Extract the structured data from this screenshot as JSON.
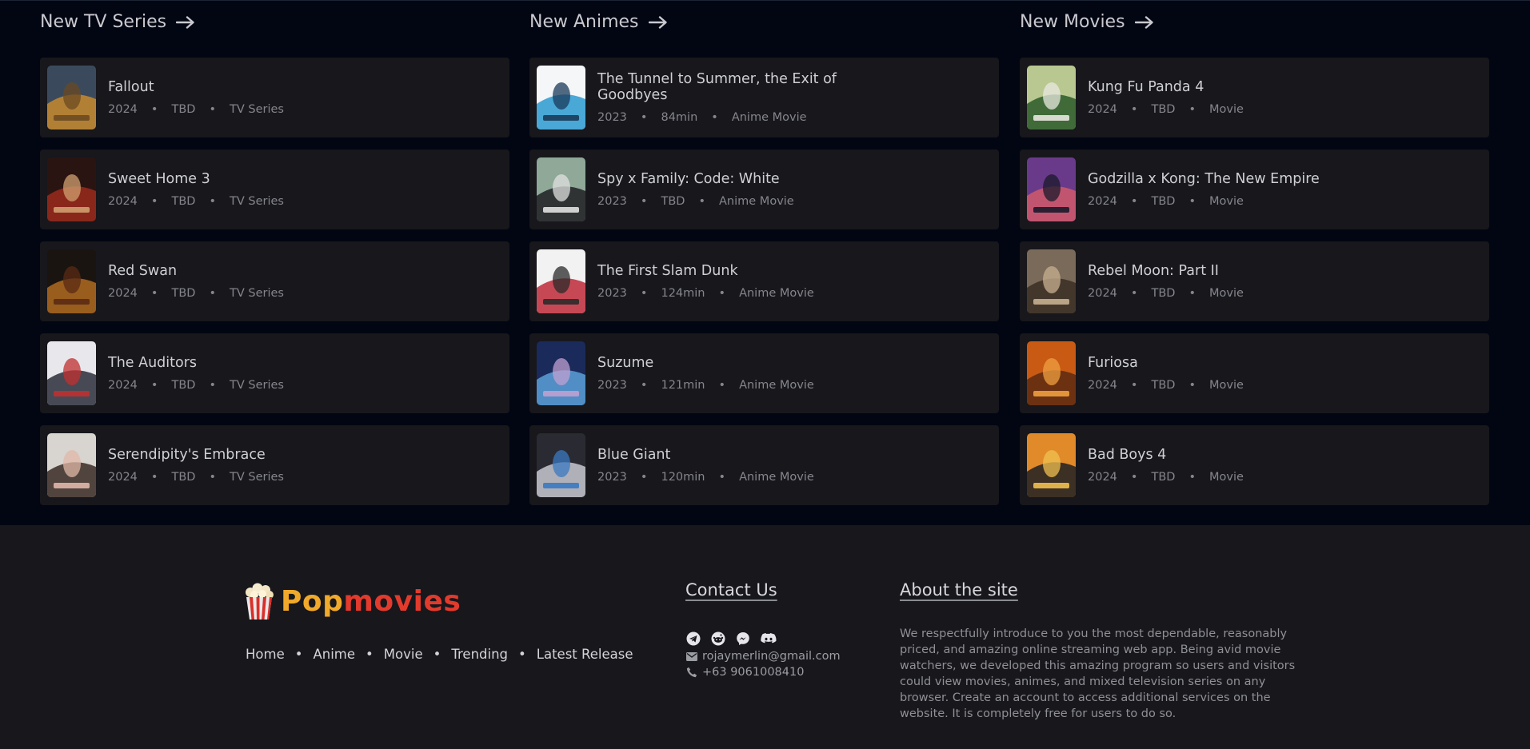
{
  "sections": [
    {
      "title": "New TV Series",
      "items": [
        {
          "title": "Fallout",
          "year": "2024",
          "duration": "TBD",
          "type": "TV Series",
          "poster_colors": [
            "#3a4a5c",
            "#c8892e",
            "#6b4a22"
          ]
        },
        {
          "title": "Sweet Home 3",
          "year": "2024",
          "duration": "TBD",
          "type": "TV Series",
          "poster_colors": [
            "#2a1412",
            "#9a2a1c",
            "#d0a070"
          ]
        },
        {
          "title": "Red Swan",
          "year": "2024",
          "duration": "TBD",
          "type": "TV Series",
          "poster_colors": [
            "#1a1410",
            "#b06a20",
            "#5a2a14"
          ]
        },
        {
          "title": "The Auditors",
          "year": "2024",
          "duration": "TBD",
          "type": "TV Series",
          "poster_colors": [
            "#e8e8ec",
            "#2a2e3a",
            "#c03030"
          ]
        },
        {
          "title": "Serendipity's Embrace",
          "year": "2024",
          "duration": "TBD",
          "type": "TV Series",
          "poster_colors": [
            "#d8d4d0",
            "#3a2a24",
            "#e0b8a8"
          ]
        }
      ]
    },
    {
      "title": "New Animes",
      "items": [
        {
          "title": "The Tunnel to Summer, the Exit of Goodbyes",
          "year": "2023",
          "duration": "84min",
          "type": "Anime Movie",
          "poster_colors": [
            "#f4f6f8",
            "#2a9ad0",
            "#1a3a5a"
          ]
        },
        {
          "title": "Spy x Family: Code: White",
          "year": "2023",
          "duration": "TBD",
          "type": "Anime Movie",
          "poster_colors": [
            "#8fa898",
            "#1e1e22",
            "#e0e2e0"
          ]
        },
        {
          "title": "The First Slam Dunk",
          "year": "2023",
          "duration": "124min",
          "type": "Anime Movie",
          "poster_colors": [
            "#f2f2f2",
            "#c02a3a",
            "#2a2a2a"
          ]
        },
        {
          "title": "Suzume",
          "year": "2023",
          "duration": "121min",
          "type": "Anime Movie",
          "poster_colors": [
            "#1a2a5a",
            "#5aa0d8",
            "#c0a0d0"
          ]
        },
        {
          "title": "Blue Giant",
          "year": "2023",
          "duration": "120min",
          "type": "Anime Movie",
          "poster_colors": [
            "#2a2a32",
            "#c8c8d0",
            "#3a7ac0"
          ]
        }
      ]
    },
    {
      "title": "New Movies",
      "items": [
        {
          "title": "Kung Fu Panda 4",
          "year": "2024",
          "duration": "TBD",
          "type": "Movie",
          "poster_colors": [
            "#b8c890",
            "#2a5a2a",
            "#e8e8e0"
          ]
        },
        {
          "title": "Godzilla x Kong: The New Empire",
          "year": "2024",
          "duration": "TBD",
          "type": "Movie",
          "poster_colors": [
            "#6a3a8a",
            "#d05a6a",
            "#1a1a2a"
          ]
        },
        {
          "title": "Rebel Moon: Part II",
          "year": "2024",
          "duration": "TBD",
          "type": "Movie",
          "poster_colors": [
            "#7a6a5a",
            "#3a2e24",
            "#c8b090"
          ]
        },
        {
          "title": "Furiosa",
          "year": "2024",
          "duration": "TBD",
          "type": "Movie",
          "poster_colors": [
            "#c85a14",
            "#5a2a10",
            "#f0a040"
          ]
        },
        {
          "title": "Bad Boys 4",
          "year": "2024",
          "duration": "TBD",
          "type": "Movie",
          "poster_colors": [
            "#e08a2a",
            "#1e1e22",
            "#f0c050"
          ]
        }
      ]
    }
  ],
  "footer": {
    "logo": {
      "part1": "Pop",
      "part2": "movies",
      "color1": "#f0a92a",
      "color2": "#e23a2c"
    },
    "nav": [
      "Home",
      "Anime",
      "Movie",
      "Trending",
      "Latest Release"
    ],
    "nav_separator": "•",
    "contact": {
      "heading": "Contact Us",
      "social_icons": [
        "telegram-icon",
        "reddit-icon",
        "messenger-icon",
        "discord-icon"
      ],
      "email": "rojaymerlin@gmail.com",
      "phone": "+63 9061008410"
    },
    "about": {
      "heading": "About the site",
      "text": "We respectfully introduce to you the most dependable, reasonably priced, and amazing online streaming web app. Being avid movie watchers, we developed this amazing program so users and visitors could view movies, animes, and mixed television series on any browser. Create an account to access additional services on the website. It is completely free for users to do so."
    }
  },
  "colors": {
    "background": "#020612",
    "card": "#17171c",
    "footer": "#17171c",
    "meta_text": "#85868d"
  }
}
